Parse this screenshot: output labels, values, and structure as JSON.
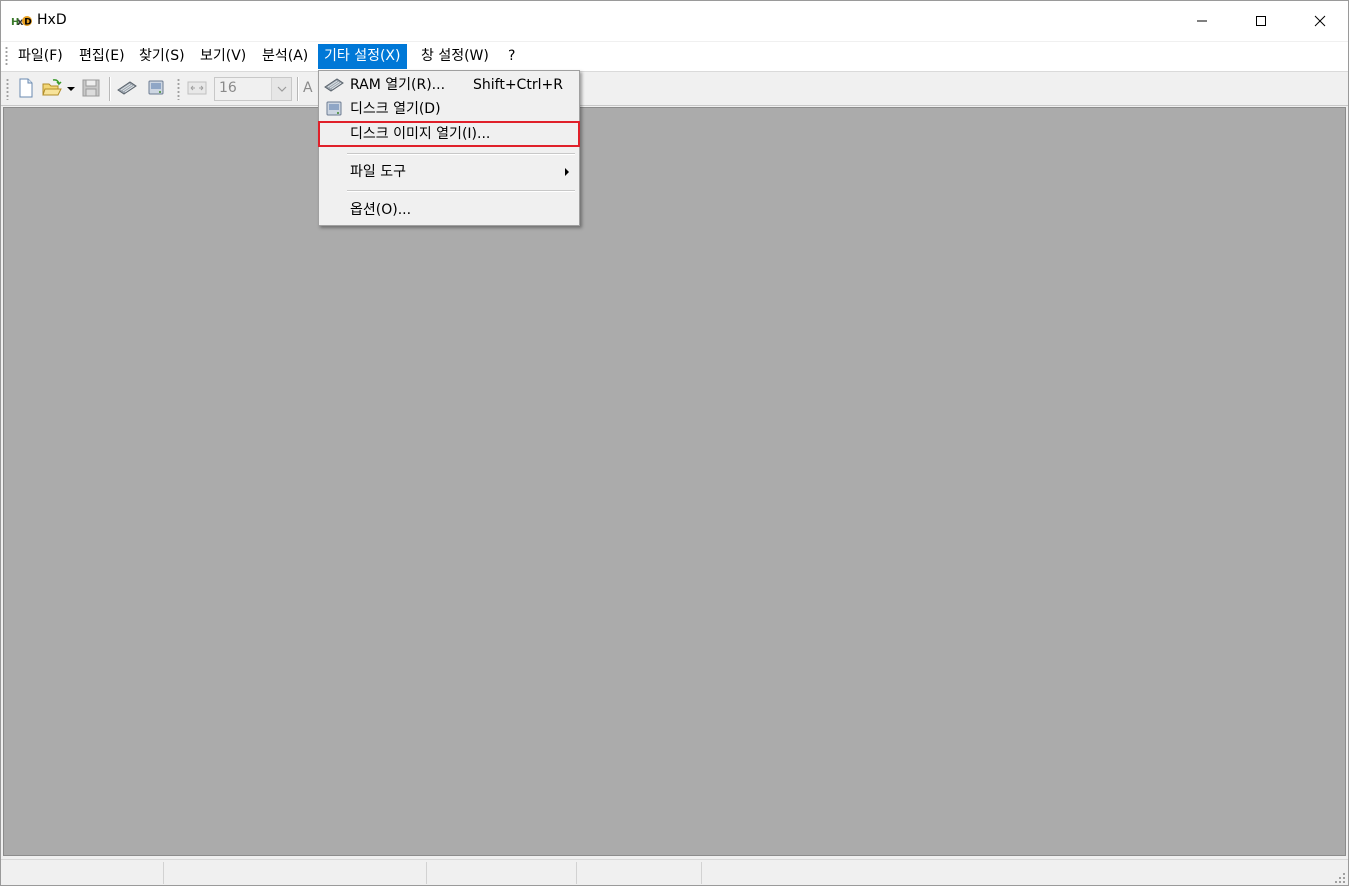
{
  "window": {
    "title": "HxD",
    "icon": "hxd-app-icon"
  },
  "menubar": {
    "items": [
      {
        "label": "파일(F)"
      },
      {
        "label": "편집(E)"
      },
      {
        "label": "찾기(S)"
      },
      {
        "label": "보기(V)"
      },
      {
        "label": "분석(A)"
      },
      {
        "label": "기타 설정(X)",
        "active": true
      },
      {
        "label": "창 설정(W)"
      },
      {
        "label": "?"
      }
    ]
  },
  "toolbar": {
    "bytes_per_row": "16",
    "partial_text": "A"
  },
  "dropdown": {
    "items": [
      {
        "label": "RAM 열기(R)...",
        "shortcut": "Shift+Ctrl+R",
        "icon": "ram-icon"
      },
      {
        "label": "디스크 열기(D)",
        "icon": "disk-icon"
      },
      {
        "label": "디스크 이미지 열기(I)...",
        "highlighted": true
      },
      {
        "label": "파일 도구",
        "has_submenu": true
      },
      {
        "label": "옵션(O)..."
      }
    ]
  },
  "colors": {
    "menu_active": "#0078d7",
    "highlight_box": "#e0202a",
    "workspace": "#ababab"
  }
}
